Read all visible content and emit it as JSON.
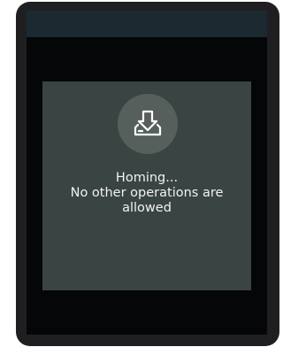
{
  "status_dialog": {
    "icon": "homing-icon",
    "message_lines": [
      "Homing...",
      "No other operations are",
      "allowed"
    ]
  },
  "colors": {
    "device_frame": "#1f1f22",
    "screen_background": "#050608",
    "top_bar": "#1b2a30",
    "dialog_background": "#3a4442",
    "icon_circle": "#575f5d",
    "text": "#f2f2f2"
  }
}
